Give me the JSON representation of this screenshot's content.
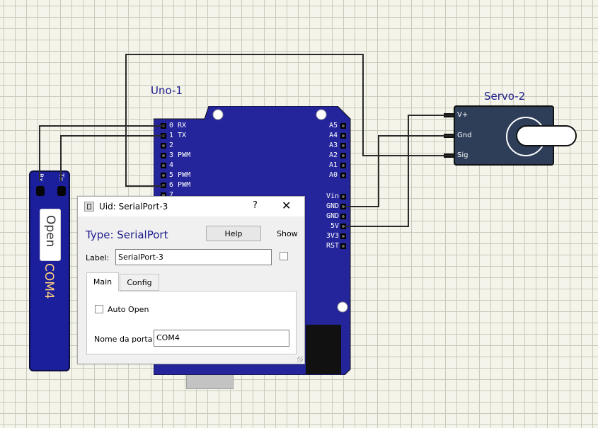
{
  "canvas": {
    "grid_color": "#c9cbbb",
    "background": "#f4f4ea"
  },
  "board": {
    "title": "Uno-1",
    "color": "#24259a",
    "left_pins": [
      "0 RX",
      "1 TX",
      "2",
      "3 PWM",
      "4",
      "5 PWM",
      "6 PWM",
      "7"
    ],
    "analog_pins": [
      "A5",
      "A4",
      "A3",
      "A2",
      "A1",
      "A0"
    ],
    "power_pins": [
      "Vin",
      "GND",
      "GND",
      "5V",
      "3V3",
      "RST"
    ]
  },
  "servo": {
    "title": "Servo-2",
    "pins": [
      "V+",
      "Gnd",
      "Sig"
    ],
    "color": "#2e3e59"
  },
  "serial_port": {
    "rx_label": "Rx",
    "tx_label": "Tx",
    "open_button": "Open",
    "port_label": "COM4",
    "color": "#1b1f9c"
  },
  "dialog": {
    "title": "Uid: SerialPort-3",
    "help_symbol": "?",
    "close_symbol": "✕",
    "type_label": "Type: SerialPort",
    "help_button": "Help",
    "show_label": "Show",
    "label_caption": "Label:",
    "label_value": "SerialPort-3",
    "tabs": [
      "Main",
      "Config"
    ],
    "active_tab": "Main",
    "auto_open_label": "Auto Open",
    "port_name_caption": "Nome da porta",
    "port_name_value": "COM4"
  }
}
